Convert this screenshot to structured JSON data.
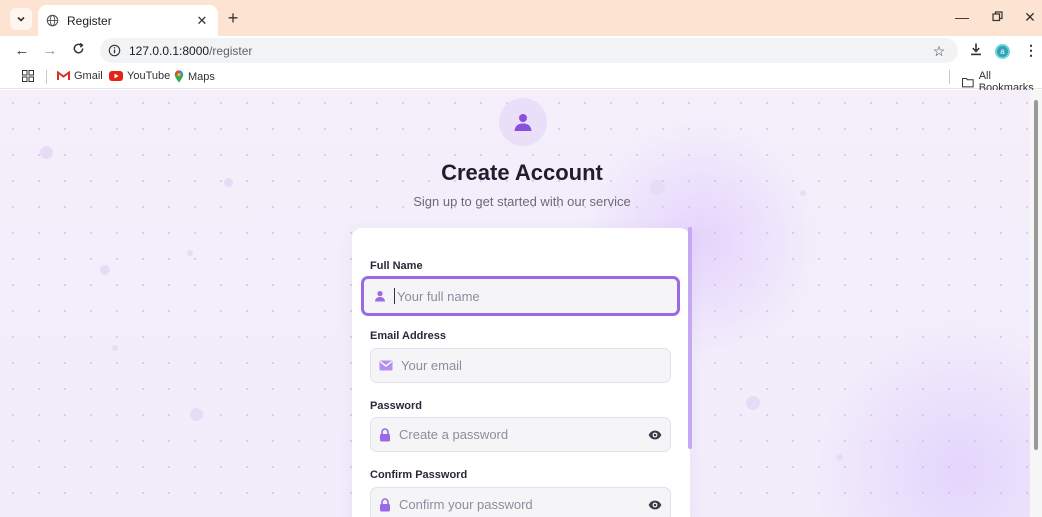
{
  "browser": {
    "tab_title": "Register",
    "url_host": "127.0.0.1:8000",
    "url_path": "/register",
    "profile_initial": "a",
    "bookmarks": [
      {
        "label": "Gmail",
        "icon": "gmail-icon"
      },
      {
        "label": "YouTube",
        "icon": "youtube-icon"
      },
      {
        "label": "Maps",
        "icon": "maps-icon"
      }
    ],
    "all_bookmarks": "All Bookmarks"
  },
  "colors": {
    "accent": "#9a6ae6",
    "tab_bar": "#fde4d2",
    "page_bg": "#f4effb"
  },
  "form": {
    "title": "Create Account",
    "subtitle": "Sign up to get started with our service",
    "fields": [
      {
        "label": "Full Name",
        "placeholder": "Your full name",
        "icon": "user-icon",
        "focused": true
      },
      {
        "label": "Email Address",
        "placeholder": "Your email",
        "icon": "envelope-icon"
      },
      {
        "label": "Password",
        "placeholder": "Create a password",
        "icon": "lock-icon",
        "toggle": "eye-icon"
      },
      {
        "label": "Confirm Password",
        "placeholder": "Confirm your password",
        "icon": "lock-icon",
        "toggle": "eye-icon"
      }
    ]
  }
}
